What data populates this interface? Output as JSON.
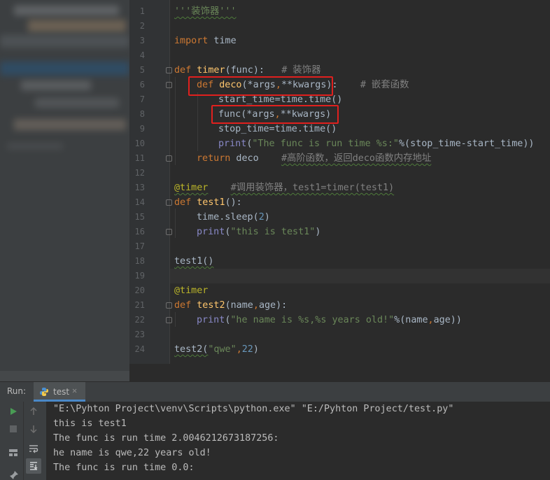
{
  "editor": {
    "line_numbers": [
      "1",
      "2",
      "3",
      "4",
      "5",
      "6",
      "7",
      "8",
      "9",
      "10",
      "11",
      "12",
      "13",
      "14",
      "15",
      "16",
      "17",
      "18",
      "19",
      "20",
      "21",
      "22",
      "23",
      "24"
    ],
    "line1": {
      "docstring": "'''装饰器'''"
    },
    "line3": {
      "kw": "import",
      "mod": " time"
    },
    "line5": {
      "kw": "def",
      "name": "timer",
      "args": "(func):",
      "comment": "# 装饰器"
    },
    "line6": {
      "kw": "def",
      "name": "deco",
      "args_pre": "(*args",
      "comma": ",",
      "args_post": "**kwargs):",
      "comment": "# 嵌套函数"
    },
    "line7": {
      "text": "start_time=time.time()"
    },
    "line8": {
      "call": "func(*args",
      "comma": ",",
      "rest": "**kwargs)"
    },
    "line9": {
      "text": "stop_time=time.time()"
    },
    "line10": {
      "fn": "print",
      "open": "(",
      "str": "\"The func is run time %s:\"",
      "rest": "%(stop_time-start_time))"
    },
    "line11": {
      "kw": "return",
      "name": " deco",
      "comment": "#高阶函数，返回deco函数内存地址"
    },
    "line13": {
      "decorator": "@timer",
      "comment": "#调用装饰器，test1=timer(test1)"
    },
    "line14": {
      "kw": "def",
      "name": "test1",
      "rest": "():"
    },
    "line15": {
      "pre": "time.sleep(",
      "num": "2",
      "post": ")"
    },
    "line16": {
      "fn": "print",
      "open": "(",
      "str": "\"this is test1\"",
      "close": ")"
    },
    "line18": {
      "text": "test1()"
    },
    "line20": {
      "decorator": "@timer"
    },
    "line21": {
      "kw": "def",
      "name": "test2",
      "pre": "(name",
      "comma": ",",
      "post": "age):"
    },
    "line22": {
      "fn": "print",
      "open": "(",
      "str": "\"he name is %s,%s years old!\"",
      "pre": "%(name",
      "comma": ",",
      "post": "age))"
    },
    "line24": {
      "pre": "test2(",
      "str": "\"qwe\"",
      "comma": ",",
      "num": "22",
      "close": ")"
    }
  },
  "run_panel": {
    "label": "Run:",
    "tab_label": "test",
    "close_glyph": "✕",
    "icons": [
      "run-icon",
      "stop-icon",
      "up-icon",
      "down-icon",
      "layout-icon",
      "soft-wrap-icon",
      "scroll-to-end-icon",
      "pin-icon"
    ],
    "output": [
      "\"E:\\Pyhton Project\\venv\\Scripts\\python.exe\" \"E:/Pyhton Project/test.py\"",
      "this is test1",
      "The func is run time 2.0046212673187256:",
      "he name is qwe,22 years old!",
      "The func is run time 0.0:"
    ]
  },
  "colors": {
    "keyword": "#cc7832",
    "function": "#ffc66d",
    "string": "#6a8759",
    "number": "#6897bb",
    "comment": "#808080",
    "decorator": "#bbb529",
    "highlight_box": "#e0201e",
    "run_green": "#499c54"
  }
}
